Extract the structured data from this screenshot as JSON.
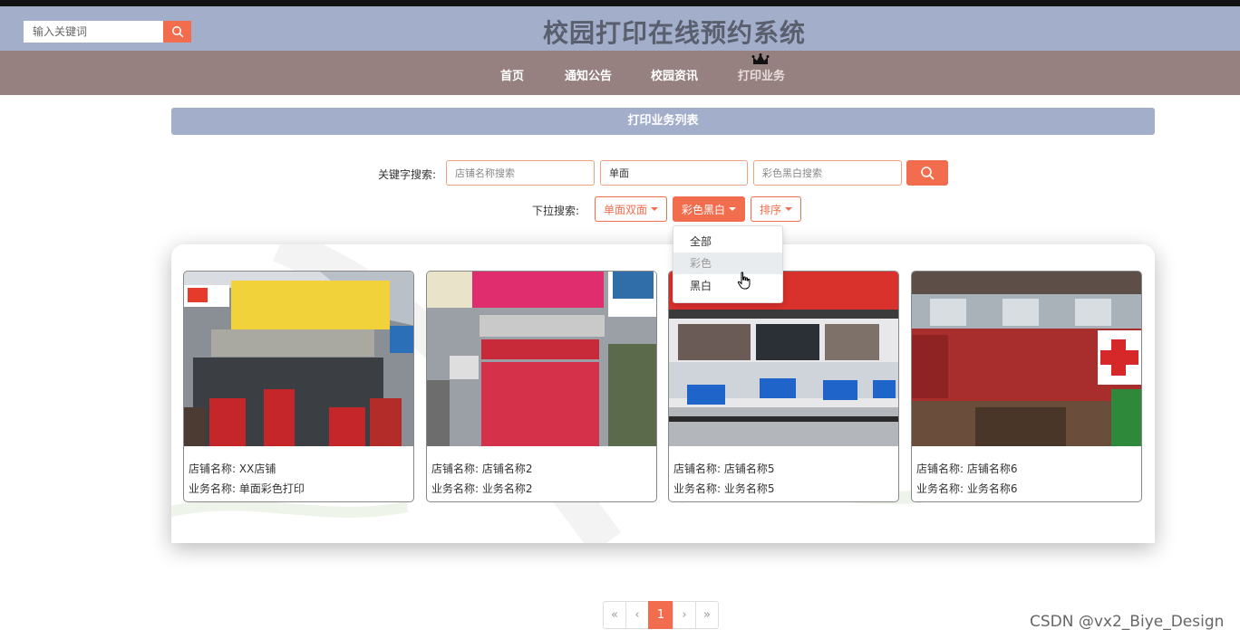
{
  "header": {
    "search_placeholder": "输入关键词",
    "title": "校园打印在线预约系统"
  },
  "nav": {
    "items": [
      "首页",
      "通知公告",
      "校园资讯",
      "打印业务"
    ],
    "active_index": 3
  },
  "section": {
    "title": "打印业务列表"
  },
  "filters": {
    "keyword_label": "关键字搜索:",
    "shop_placeholder": "店铺名称搜索",
    "side_value": "单面",
    "color_placeholder": "彩色黑白搜索",
    "dropdown_label": "下拉搜索:",
    "dropdowns": [
      "单面双面",
      "彩色黑白",
      "排序"
    ],
    "color_options": [
      "全部",
      "彩色",
      "黑白"
    ],
    "hover_option_index": 1
  },
  "cards": [
    {
      "shop_label": "店铺名称:",
      "shop_name": "XX店铺",
      "business_label": "业务名称:",
      "business_name": "单面彩色打印"
    },
    {
      "shop_label": "店铺名称:",
      "shop_name": "店铺名称2",
      "business_label": "业务名称:",
      "business_name": "业务名称2"
    },
    {
      "shop_label": "店铺名称:",
      "shop_name": "店铺名称5",
      "business_label": "业务名称:",
      "business_name": "业务名称5"
    },
    {
      "shop_label": "店铺名称:",
      "shop_name": "店铺名称6",
      "business_label": "业务名称:",
      "business_name": "业务名称6"
    }
  ],
  "pagination": {
    "first": "«",
    "prev": "‹",
    "current": "1",
    "next": "›",
    "last": "»"
  },
  "watermark": "CSDN @vx2_Biye_Design",
  "colors": {
    "header_bg": "#a3aecb",
    "nav_bg": "#978080",
    "accent": "#f26d4d",
    "title_text": "#5a5f6e"
  }
}
